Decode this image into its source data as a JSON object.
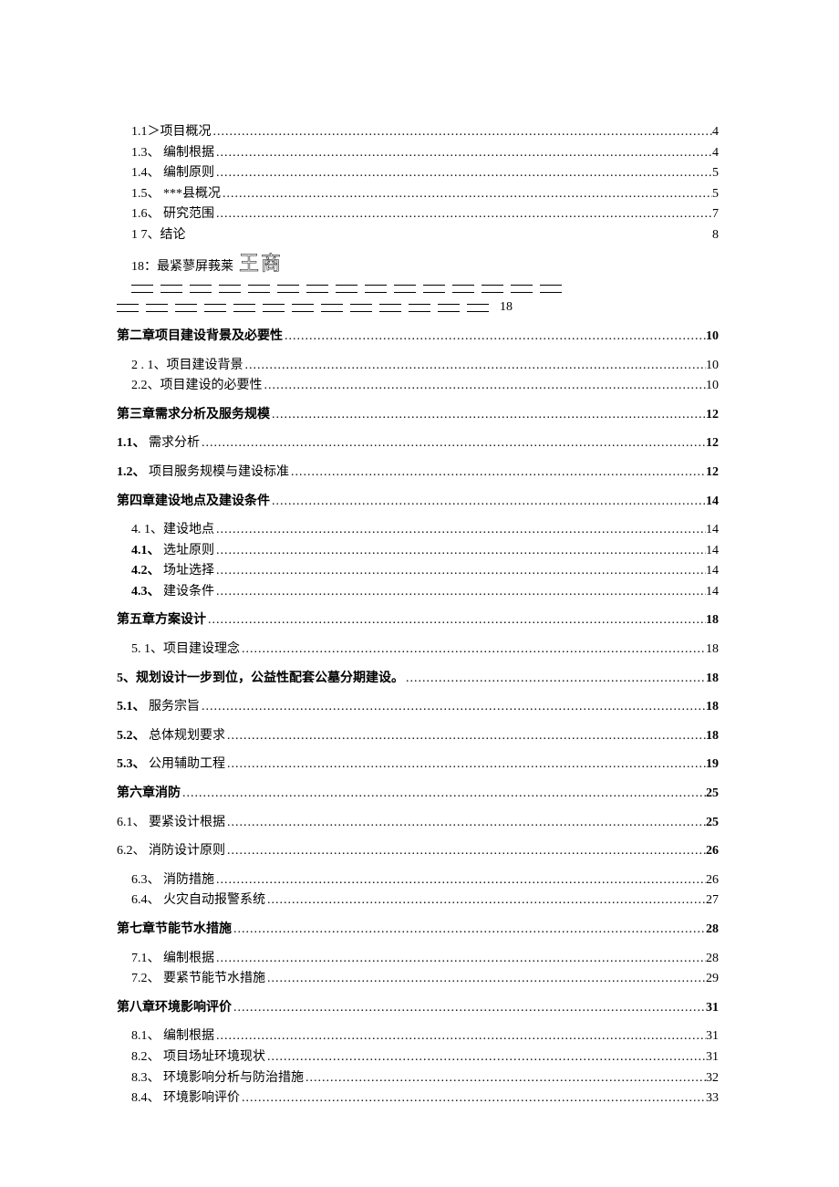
{
  "lines": {
    "l01": {
      "label": "1.1＞项目概况",
      "page": "4"
    },
    "l02": {
      "label": "1.3、 编制根据",
      "page": "4"
    },
    "l03": {
      "label": "1.4、 编制原则",
      "page": "5"
    },
    "l04": {
      "label": "1.5、 ***县概况",
      "page": "5"
    },
    "l05": {
      "label": "1.6、 研究范围",
      "page": "7"
    },
    "l06": {
      "label": "1 7、结论",
      "page": "8"
    },
    "l07": {
      "prefix": "18：最紧蓼屏莪莱",
      "outline": "王商"
    },
    "l07b": {
      "page": "18"
    },
    "l08": {
      "label": "第二章项目建设背景及必要性",
      "page": "10"
    },
    "l09": {
      "label": "2 . 1、项目建设背景",
      "page": "10"
    },
    "l10": {
      "label": "2.2、项目建设的必要性",
      "page": "10"
    },
    "l11": {
      "label": "第三章需求分析及服务规模",
      "page": "12"
    },
    "l12": {
      "label_bold": "1.1、",
      "label_rest": " 需求分析",
      "page": "12"
    },
    "l13": {
      "label_bold": "1.2、",
      "label_rest": " 项目服务规模与建设标准",
      "page": "12"
    },
    "l14": {
      "label": "第四章建设地点及建设条件",
      "page": "14"
    },
    "l15": {
      "label": "4. 1、建设地点",
      "page": "14"
    },
    "l16": {
      "label_bold": "4.1、",
      "label_rest": " 选址原则",
      "page": "14"
    },
    "l17": {
      "label_bold": "4.2、",
      "label_rest": " 场址选择",
      "page": "14"
    },
    "l18": {
      "label_bold": "4.3、",
      "label_rest": " 建设条件",
      "page": "14"
    },
    "l19": {
      "label": "第五章方案设计",
      "page": "18"
    },
    "l20": {
      "label": "5. 1、项目建设理念",
      "page": "18"
    },
    "l21": {
      "label_bold": "5",
      "label_rest": "、规划设计一步到位，公益性配套公墓分期建设。",
      "page": "18"
    },
    "l22": {
      "label_bold": "5.1、",
      "label_rest": " 服务宗旨",
      "page": "18"
    },
    "l23": {
      "label_bold": "5.2、",
      "label_rest": " 总体规划要求",
      "page": "18"
    },
    "l24": {
      "label_bold": "5.3、",
      "label_rest": " 公用辅助工程",
      "page": "19"
    },
    "l25": {
      "label": "第六章消防",
      "page": "25"
    },
    "l26": {
      "label": "6.1、 要紧设计根据",
      "page": "25"
    },
    "l27": {
      "label": "6.2、 消防设计原则",
      "page": "26"
    },
    "l28": {
      "label": "6.3、 消防措施",
      "page": "26"
    },
    "l29": {
      "label": "6.4、 火灾自动报警系统",
      "page": "27"
    },
    "l30": {
      "label": "第七章节能节水措施",
      "page": "28"
    },
    "l31": {
      "label": "7.1、 编制根据",
      "page": "28"
    },
    "l32": {
      "label": "7.2、 要紧节能节水措施",
      "page": "29"
    },
    "l33": {
      "label": "第八章环境影响评价",
      "page": "31"
    },
    "l34": {
      "label": "8.1、 编制根据",
      "page": "31"
    },
    "l35": {
      "label": "8.2、 项目场址环境现状",
      "page": "31"
    },
    "l36": {
      "label": "8.3、 环境影响分析与防治措施",
      "page": "32"
    },
    "l37": {
      "label": "8.4、 环境影响评价",
      "page": "33"
    }
  }
}
